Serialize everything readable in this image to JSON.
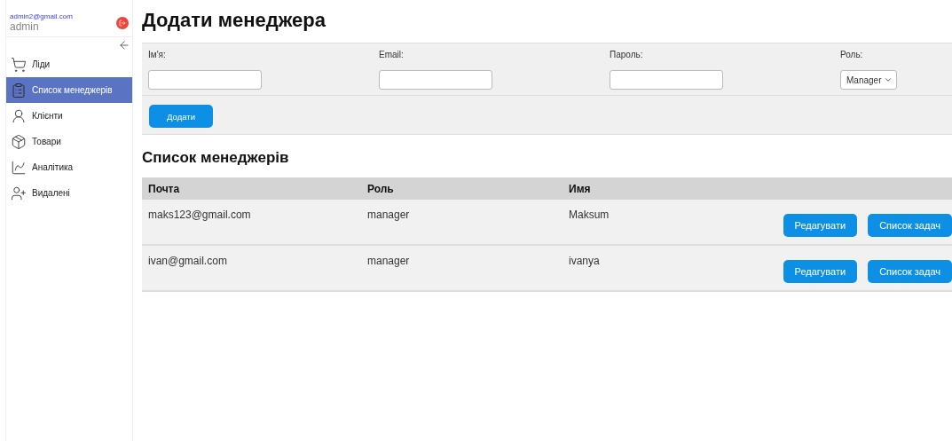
{
  "user": {
    "email": "admin2@gmail.com",
    "name": "admin"
  },
  "sidebar": {
    "items": [
      {
        "kind": "cart",
        "label": "Ліди",
        "selected": false
      },
      {
        "kind": "clipboard",
        "label": "Список менеджерів",
        "selected": true
      },
      {
        "kind": "client",
        "label": "Клієнти",
        "selected": false
      },
      {
        "kind": "box",
        "label": "Товари",
        "selected": false
      },
      {
        "kind": "chart",
        "label": "Аналітика",
        "selected": false
      },
      {
        "kind": "userplus",
        "label": "Видалені",
        "selected": false
      }
    ]
  },
  "title": "Додати менеджера",
  "form": {
    "fields": [
      {
        "kind": "text",
        "label": "Ім'я:"
      },
      {
        "kind": "text",
        "label": "Email:"
      },
      {
        "kind": "text",
        "label": "Пароль:"
      },
      {
        "kind": "select",
        "label": "Роль:",
        "value": "Manager"
      }
    ],
    "submit": "Додати"
  },
  "list_title": "Список менеджерів",
  "table": {
    "columns": [
      "Почта",
      "Роль",
      "Имя"
    ],
    "rows": [
      {
        "cells": [
          "maks123@gmail.com",
          "manager",
          "Maksum"
        ],
        "actions": [
          "Редагувати",
          "Список задач"
        ]
      },
      {
        "cells": [
          "ivan@gmail.com",
          "manager",
          "ivanya"
        ],
        "actions": [
          "Редагувати",
          "Список задач"
        ]
      }
    ]
  }
}
